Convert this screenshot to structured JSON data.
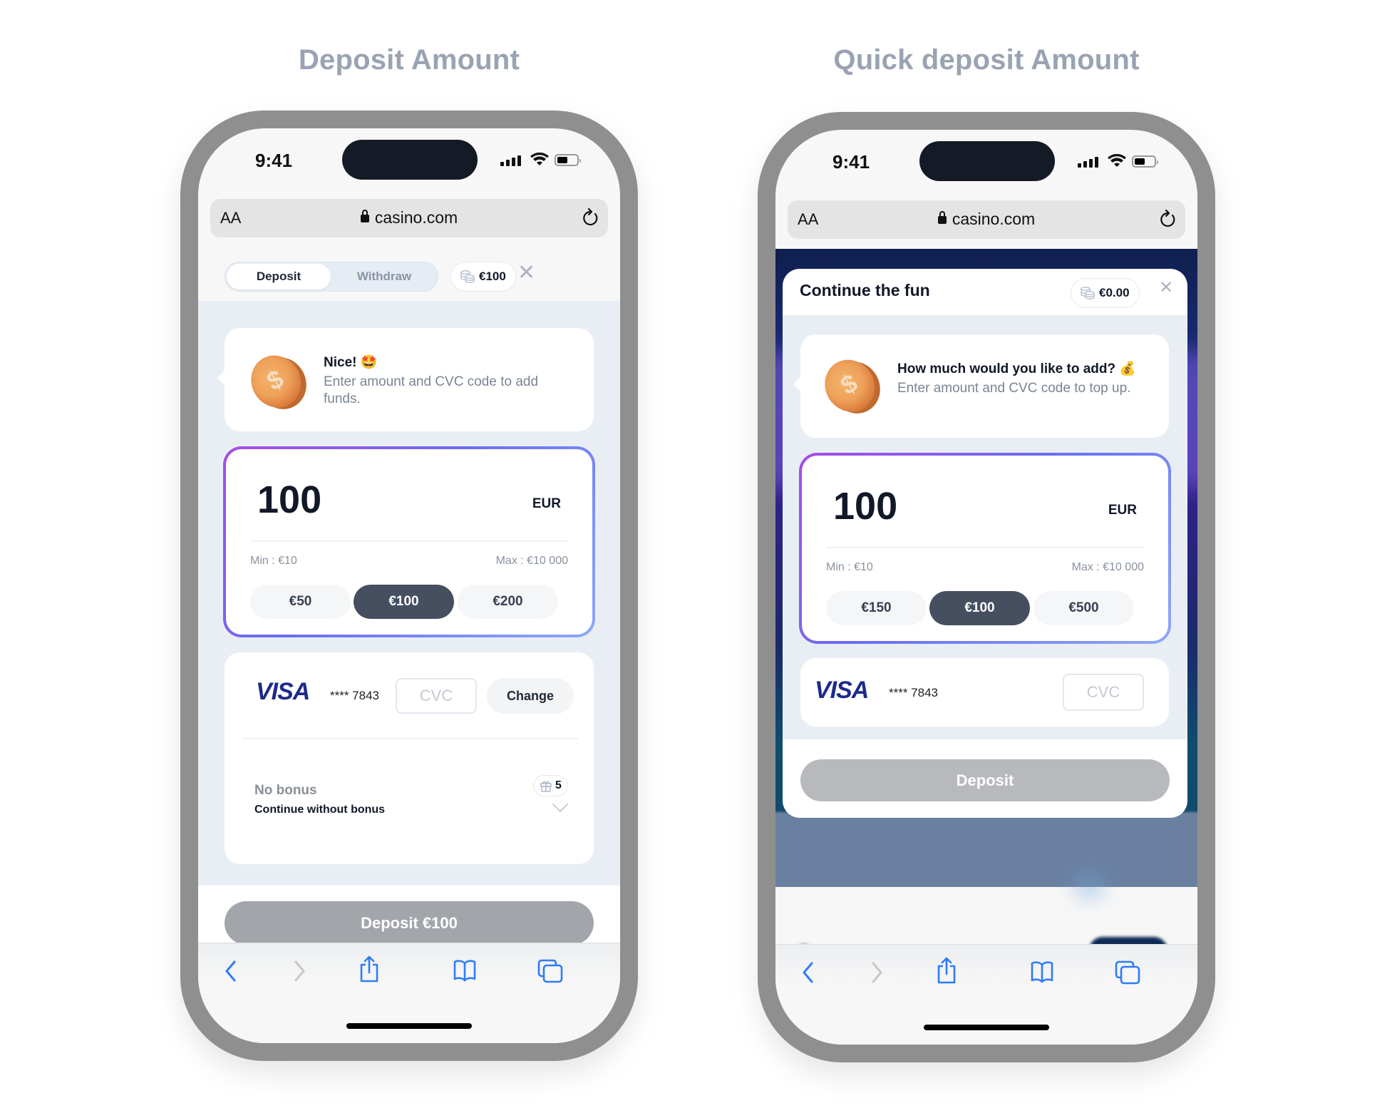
{
  "headings": {
    "left": "Deposit Amount",
    "right": "Quick deposit Amount"
  },
  "status_bar": {
    "time": "9:41"
  },
  "browser": {
    "text_size_label": "AA",
    "url": "casino.com",
    "icons": [
      "lock-icon",
      "reload-icon",
      "back-icon",
      "forward-icon",
      "share-icon",
      "bookmarks-icon",
      "tabs-icon"
    ]
  },
  "deposit_screen": {
    "tabs": [
      {
        "label": "Deposit",
        "active": true
      },
      {
        "label": "Withdraw",
        "active": false
      }
    ],
    "balance": "€100",
    "message": {
      "title": "Nice! 🤩",
      "body": "Enter amount and CVC code to add funds."
    },
    "amount": {
      "value": "100",
      "currency": "EUR",
      "min": "Min : €10",
      "max": "Max : €10 000"
    },
    "quick_amounts": [
      {
        "label": "€50",
        "selected": false
      },
      {
        "label": "€100",
        "selected": true
      },
      {
        "label": "€200",
        "selected": false
      }
    ],
    "payment": {
      "brand": "VISA",
      "card_number": "**** 7843",
      "cvc_placeholder": "CVC",
      "change_label": "Change"
    },
    "bonus": {
      "title": "No bonus",
      "subtitle": "Continue without bonus",
      "count": "5"
    },
    "submit_label": "Deposit €100"
  },
  "quick_deposit_screen": {
    "title": "Continue the fun",
    "balance": "€0.00",
    "message": {
      "title": "How much would you like to add? 💰",
      "body": "Enter amount and CVC code to top up."
    },
    "amount": {
      "value": "100",
      "currency": "EUR",
      "min": "Min : €10",
      "max": "Max : €10 000"
    },
    "quick_amounts": [
      {
        "label": "€150",
        "selected": false
      },
      {
        "label": "€100",
        "selected": true
      },
      {
        "label": "€500",
        "selected": false
      }
    ],
    "payment": {
      "brand": "VISA",
      "card_number": "**** 7843",
      "cvc_placeholder": "CVC"
    },
    "submit_label": "Deposit"
  },
  "colors": {
    "accent_gradient_start": "#a64be6",
    "accent_gradient_end": "#8ea8f8",
    "selected_chip": "#454f60",
    "disabled_button": "#a2a5aa",
    "safari_blue": "#2f7cf6",
    "visa_blue": "#1d2a8c"
  }
}
